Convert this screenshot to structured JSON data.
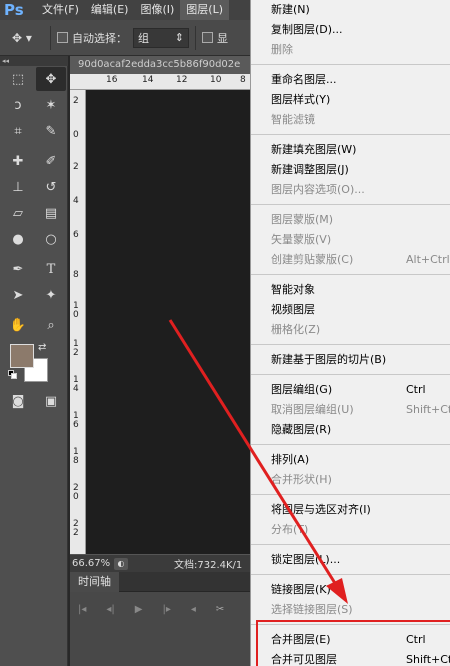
{
  "app": {
    "logo": "Ps"
  },
  "menubar": {
    "items": [
      "文件(F)",
      "编辑(E)",
      "图像(I)",
      "图层(L)"
    ]
  },
  "options": {
    "auto_select_label": "自动选择：",
    "auto_select_value": "组",
    "trailing_label": "显"
  },
  "document": {
    "tab_title": "90d0acaf2edda3cc5b86f90d02e",
    "ruler_top": [
      "16",
      "14",
      "12",
      "10",
      "8"
    ],
    "ruler_left": [
      "2",
      "0",
      "2",
      "4",
      "6",
      "8",
      "1\n0",
      "1\n2",
      "1\n4",
      "1\n6",
      "1\n8",
      "2\n0",
      "2\n2"
    ],
    "zoom": "66.67%",
    "doc_size": "文档:732.4K/1"
  },
  "timeline": {
    "tab_label": "时间轴"
  },
  "colors": {
    "foreground": "#8c7a6b",
    "background": "#ffffff",
    "highlight_box": "#e02020",
    "arrow": "#e02020"
  },
  "layer_menu": {
    "groups": [
      [
        {
          "label": "新建(N)",
          "shortcut": "",
          "disabled": false
        },
        {
          "label": "复制图层(D)...",
          "shortcut": "",
          "disabled": false
        },
        {
          "label": "删除",
          "shortcut": "",
          "disabled": true
        }
      ],
      [
        {
          "label": "重命名图层...",
          "shortcut": "",
          "disabled": false
        },
        {
          "label": "图层样式(Y)",
          "shortcut": "",
          "disabled": false
        },
        {
          "label": "智能滤镜",
          "shortcut": "",
          "disabled": true
        }
      ],
      [
        {
          "label": "新建填充图层(W)",
          "shortcut": "",
          "disabled": false
        },
        {
          "label": "新建调整图层(J)",
          "shortcut": "",
          "disabled": false
        },
        {
          "label": "图层内容选项(O)...",
          "shortcut": "",
          "disabled": true
        }
      ],
      [
        {
          "label": "图层蒙版(M)",
          "shortcut": "",
          "disabled": true
        },
        {
          "label": "矢量蒙版(V)",
          "shortcut": "",
          "disabled": true
        },
        {
          "label": "创建剪贴蒙版(C)",
          "shortcut": "Alt+Ctrl",
          "disabled": true
        }
      ],
      [
        {
          "label": "智能对象",
          "shortcut": "",
          "disabled": false
        },
        {
          "label": "视频图层",
          "shortcut": "",
          "disabled": false
        },
        {
          "label": "栅格化(Z)",
          "shortcut": "",
          "disabled": true
        }
      ],
      [
        {
          "label": "新建基于图层的切片(B)",
          "shortcut": "",
          "disabled": false
        }
      ],
      [
        {
          "label": "图层编组(G)",
          "shortcut": "Ctrl",
          "disabled": false
        },
        {
          "label": "取消图层编组(U)",
          "shortcut": "Shift+Ctrl",
          "disabled": true
        },
        {
          "label": "隐藏图层(R)",
          "shortcut": "",
          "disabled": false
        }
      ],
      [
        {
          "label": "排列(A)",
          "shortcut": "",
          "disabled": false
        },
        {
          "label": "合并形状(H)",
          "shortcut": "",
          "disabled": true
        }
      ],
      [
        {
          "label": "将图层与选区对齐(I)",
          "shortcut": "",
          "disabled": false
        },
        {
          "label": "分布(T)",
          "shortcut": "",
          "disabled": true
        }
      ],
      [
        {
          "label": "锁定图层(L)...",
          "shortcut": "",
          "disabled": false
        }
      ],
      [
        {
          "label": "链接图层(K)",
          "shortcut": "",
          "disabled": false
        },
        {
          "label": "选择链接图层(S)",
          "shortcut": "",
          "disabled": true
        }
      ],
      [
        {
          "label": "合并图层(E)",
          "shortcut": "Ctrl",
          "disabled": false
        },
        {
          "label": "合并可见图层",
          "shortcut": "Shift+Ctrl",
          "disabled": false
        }
      ]
    ]
  }
}
